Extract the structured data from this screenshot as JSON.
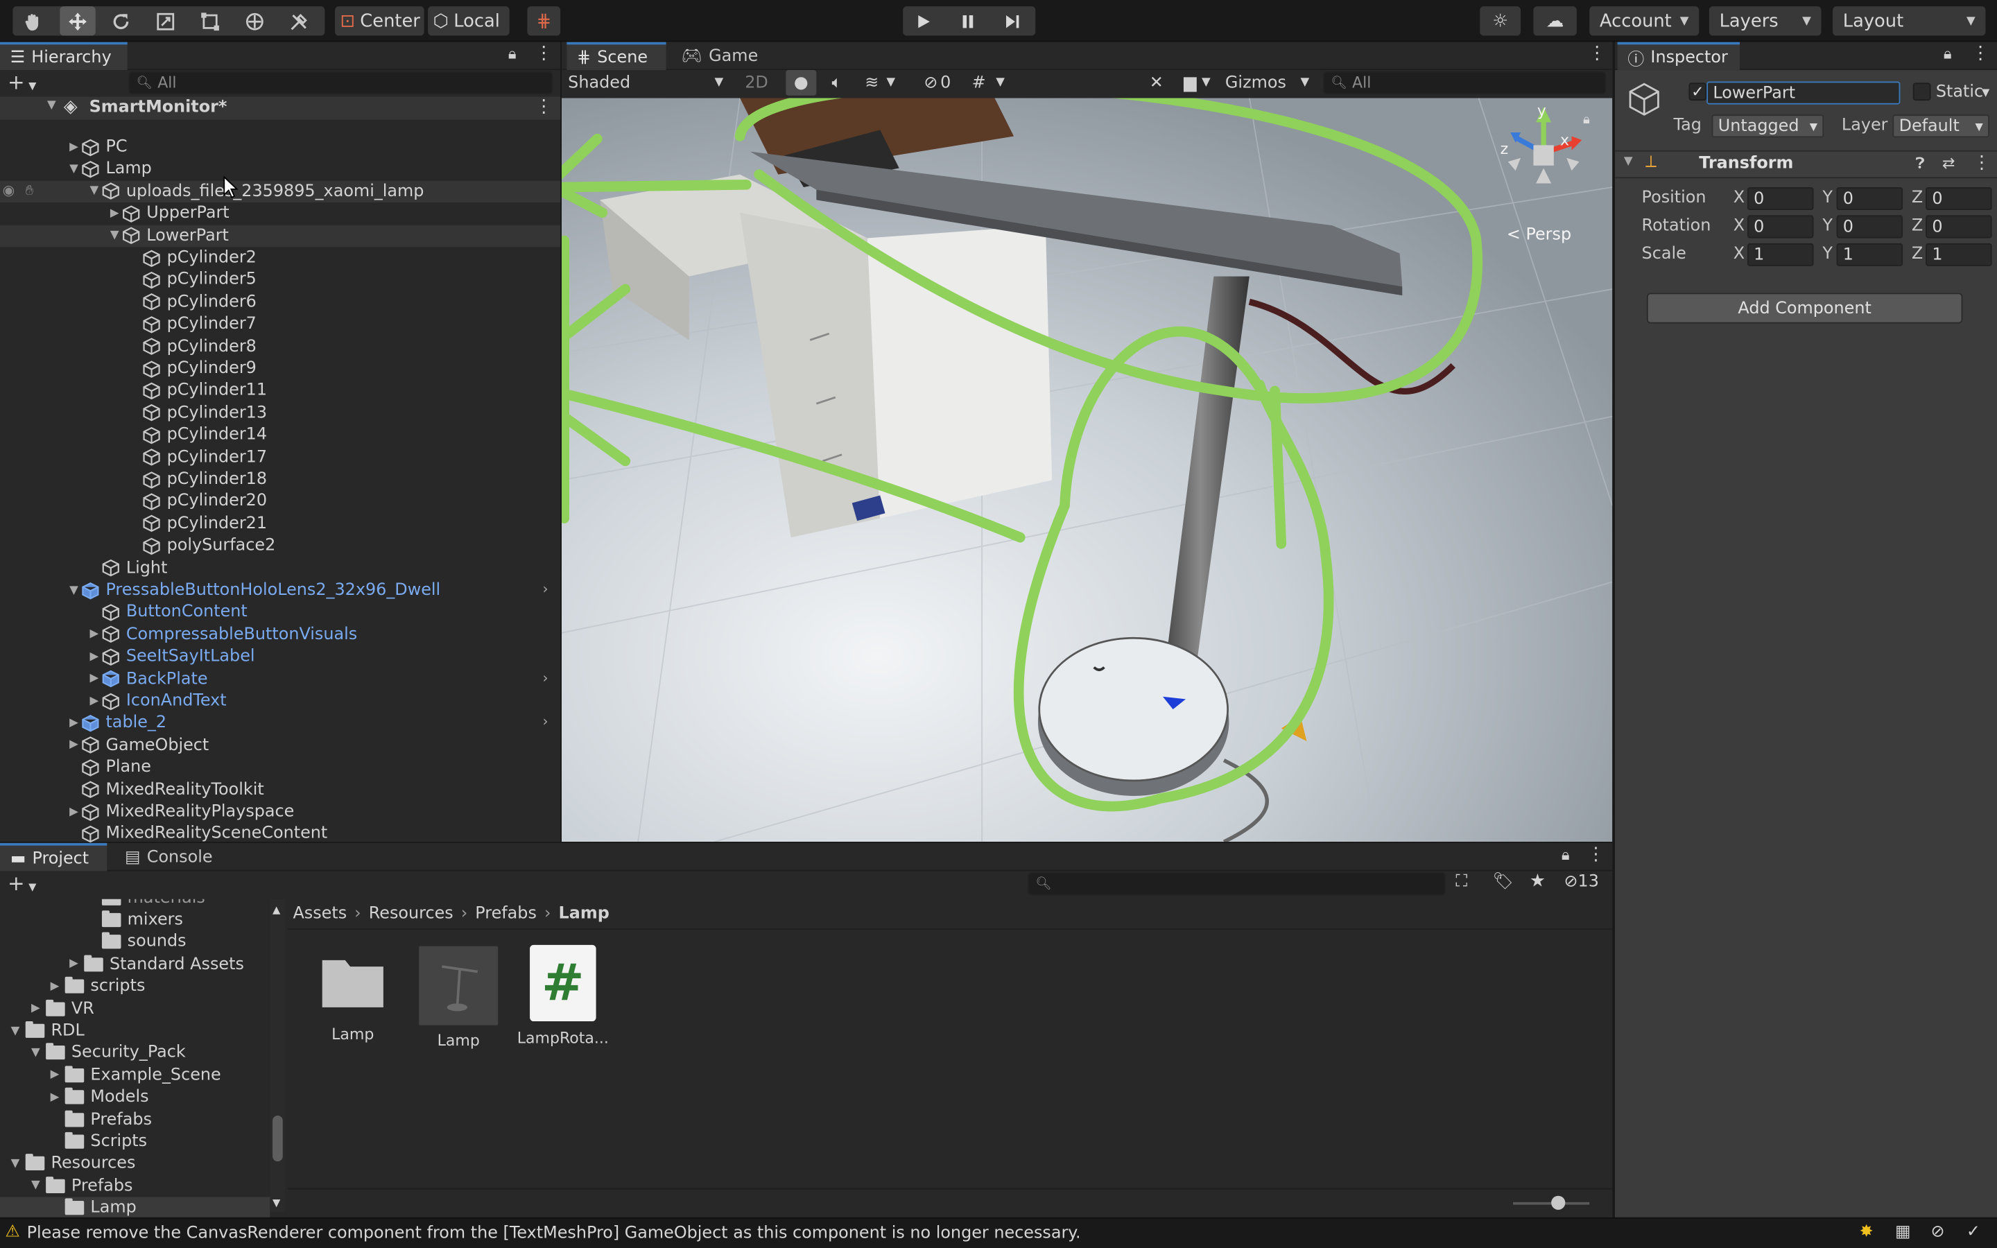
{
  "toolbar": {
    "pivot_label": "Center",
    "space_label": "Local",
    "account_label": "Account",
    "layers_label": "Layers",
    "layout_label": "Layout"
  },
  "hierarchy": {
    "tab_label": "Hierarchy",
    "search_placeholder": "All",
    "scene_name": "SmartMonitor*",
    "rows": [
      {
        "label": "PC"
      },
      {
        "label": "Lamp"
      },
      {
        "label": "uploads_files_2359895_xaomi_lamp"
      },
      {
        "label": "UpperPart"
      },
      {
        "label": "LowerPart"
      },
      {
        "label": "pCylinder2"
      },
      {
        "label": "pCylinder5"
      },
      {
        "label": "pCylinder6"
      },
      {
        "label": "pCylinder7"
      },
      {
        "label": "pCylinder8"
      },
      {
        "label": "pCylinder9"
      },
      {
        "label": "pCylinder11"
      },
      {
        "label": "pCylinder13"
      },
      {
        "label": "pCylinder14"
      },
      {
        "label": "pCylinder17"
      },
      {
        "label": "pCylinder18"
      },
      {
        "label": "pCylinder20"
      },
      {
        "label": "pCylinder21"
      },
      {
        "label": "polySurface2"
      },
      {
        "label": "Light"
      },
      {
        "label": "PressableButtonHoloLens2_32x96_Dwell"
      },
      {
        "label": "ButtonContent"
      },
      {
        "label": "CompressableButtonVisuals"
      },
      {
        "label": "SeeItSayItLabel"
      },
      {
        "label": "BackPlate"
      },
      {
        "label": "IconAndText"
      },
      {
        "label": "table_2"
      },
      {
        "label": "GameObject"
      },
      {
        "label": "Plane"
      },
      {
        "label": "MixedRealityToolkit"
      },
      {
        "label": "MixedRealityPlayspace"
      },
      {
        "label": "MixedRealitySceneContent"
      }
    ]
  },
  "scene": {
    "tab_scene": "Scene",
    "tab_game": "Game",
    "shading_mode": "Shaded",
    "mode_2d": "2D",
    "hidden_count": "0",
    "gizmos_label": "Gizmos",
    "search_placeholder": "All",
    "projection_label": "< Persp",
    "axis_x": "x",
    "axis_y": "y",
    "axis_z": "z"
  },
  "inspector": {
    "tab_label": "Inspector",
    "object_name": "LowerPart",
    "static_label": "Static",
    "tag_label": "Tag",
    "tag_value": "Untagged",
    "layer_label": "Layer",
    "layer_value": "Default",
    "component_title": "Transform",
    "position_label": "Position",
    "rotation_label": "Rotation",
    "scale_label": "Scale",
    "axis_x": "X",
    "axis_y": "Y",
    "axis_z": "Z",
    "position": {
      "x": "0",
      "y": "0",
      "z": "0"
    },
    "rotation": {
      "x": "0",
      "y": "0",
      "z": "0"
    },
    "scale": {
      "x": "1",
      "y": "1",
      "z": "1"
    },
    "add_component_label": "Add Component"
  },
  "project": {
    "tab_project": "Project",
    "tab_console": "Console",
    "hidden_count": "13",
    "tree_partial": "materials",
    "tree": [
      {
        "label": "mixers"
      },
      {
        "label": "sounds"
      },
      {
        "label": "Standard Assets"
      },
      {
        "label": "scripts"
      },
      {
        "label": "VR"
      },
      {
        "label": "RDL"
      },
      {
        "label": "Security_Pack"
      },
      {
        "label": "Example_Scene"
      },
      {
        "label": "Models"
      },
      {
        "label": "Prefabs"
      },
      {
        "label": "Scripts"
      },
      {
        "label": "Resources"
      },
      {
        "label": "Prefabs"
      },
      {
        "label": "Lamp"
      }
    ],
    "breadcrumb": [
      "Assets",
      "Resources",
      "Prefabs",
      "Lamp"
    ],
    "assets": [
      {
        "label": "Lamp",
        "kind": "folder-icon"
      },
      {
        "label": "Lamp",
        "kind": "prefab-thumbnail"
      },
      {
        "label": "LampRota...",
        "kind": "csharp-script-icon"
      }
    ],
    "script_glyph": "#"
  },
  "status": {
    "message": "Please remove the CanvasRenderer component from the [TextMeshPro] GameObject as this component is no longer necessary."
  },
  "colors": {
    "annotation_green": "#8fd15a",
    "selection_blue": "#3a79bb",
    "prefab_text_blue": "#7aaaf0",
    "warning_yellow": "#f0c020"
  }
}
